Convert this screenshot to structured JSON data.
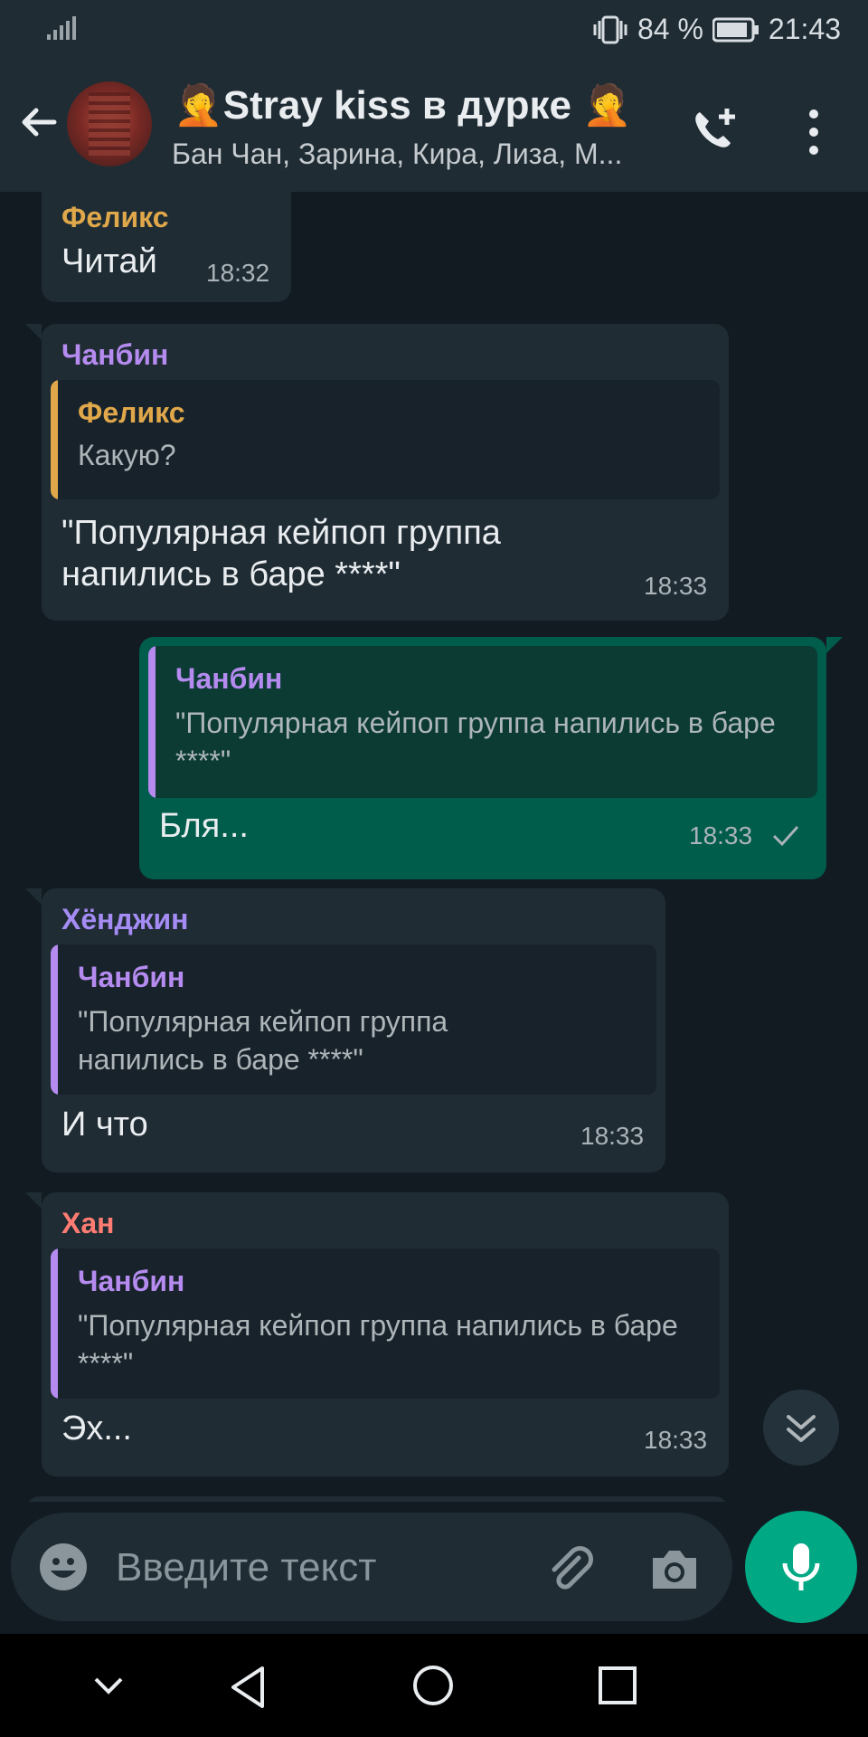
{
  "status": {
    "battery": "84 %",
    "time": "21:43"
  },
  "header": {
    "title": "🤦Stray kiss в дурке 🤦",
    "subtitle": "Бан Чан, Зарина, Кира, Лиза, М..."
  },
  "messages": [
    {
      "sender": "Феликс",
      "text": "Читай",
      "time": "18:32"
    },
    {
      "sender": "Чанбин",
      "quote_name": "Феликс",
      "quote_text": "Какую?",
      "text": "\"Популярная кейпоп группа напились в баре ****\"",
      "time": "18:33"
    },
    {
      "quote_name": "Чанбин",
      "quote_text": "\"Популярная кейпоп группа напились в баре ****\"",
      "text": "Бля...",
      "time": "18:33"
    },
    {
      "sender": "Хёнджин",
      "quote_name": "Чанбин",
      "quote_text": "\"Популярная кейпоп группа напились в баре ****\"",
      "text": "И что",
      "time": "18:33"
    },
    {
      "sender": "Хан",
      "quote_name": "Чанбин",
      "quote_text": "\"Популярная кейпоп группа напились в баре ****\"",
      "text": "Эх...",
      "time": "18:33"
    }
  ],
  "composer": {
    "placeholder": "Введите текст"
  },
  "colors": {
    "felix": "#e0a84a",
    "changbin": "#b58bf0",
    "hyunjin": "#a58cf5",
    "han": "#ff7c72",
    "accent": "#00a884"
  }
}
